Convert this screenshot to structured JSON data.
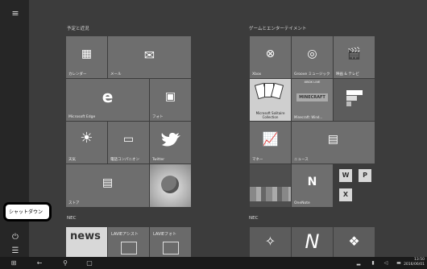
{
  "group1": {
    "title": "予定と近況"
  },
  "group2": {
    "title": "ゲームとエンターテイメント"
  },
  "group3": {
    "title": "NEC"
  },
  "group4": {
    "title": "NEC"
  },
  "tiles": {
    "calendar": "カレンダー",
    "mail": "メール",
    "edge": "Microsoft Edge",
    "photos": "フォト",
    "weather": "天気",
    "phone": "電話コンパニオン",
    "twitter": "Twitter",
    "store": "ストア",
    "xbox": "Xbox",
    "groove": "Groove ミュージック",
    "movies": "映画 & テレビ",
    "solitaire": "Microsoft Solitaire Collection",
    "minecraft_tag": "XBOX LIVE",
    "minecraft": "Minecraft: Wind...",
    "money": "マネー",
    "news": "ニュース",
    "onenote": "OneNote",
    "nec_news": "news",
    "lavie_assist": "LAVIEアシスト",
    "lavie_photo": "LAVIEフォト"
  },
  "shutdown": {
    "label": "シャットダウン"
  },
  "taskbar": {
    "time": "13:50",
    "date": "2016/06/01"
  },
  "icons": [
    "hamburger-icon",
    "power-icon",
    "all-apps-icon",
    "windows-logo-icon",
    "back-icon",
    "search-icon",
    "task-view-icon",
    "calendar-icon",
    "mail-icon",
    "edge-icon",
    "photos-icon",
    "weather-icon",
    "phone-icon",
    "twitter-icon",
    "store-icon",
    "xbox-icon",
    "groove-icon",
    "movies-icon",
    "money-icon",
    "news-icon",
    "onenote-icon",
    "word-icon",
    "publisher-icon",
    "excel-icon"
  ]
}
